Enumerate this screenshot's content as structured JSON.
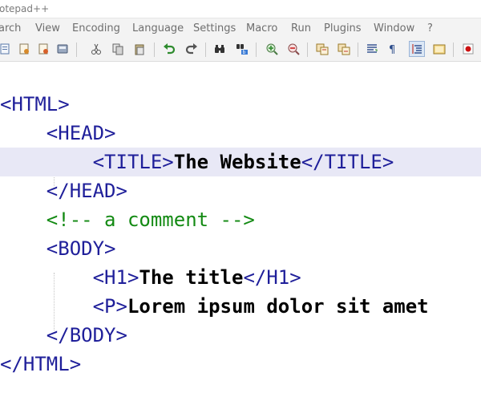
{
  "window": {
    "title": "otepad++"
  },
  "menubar": {
    "items": [
      "arch",
      "View",
      "Encoding",
      "Language",
      "Settings",
      "Macro",
      "Run",
      "Plugins",
      "Window",
      "?"
    ]
  },
  "toolbar": {
    "buttons": [
      "new-file-icon",
      "open-file-icon",
      "save-icon",
      "save-all-icon",
      "print-icon",
      "cut-icon",
      "copy-icon",
      "paste-icon",
      "undo-icon",
      "redo-icon",
      "find-icon",
      "replace-icon",
      "zoom-in-icon",
      "zoom-out-icon",
      "sync-vertical-icon",
      "sync-horizontal-icon",
      "word-wrap-icon",
      "show-all-chars-icon",
      "indent-guide-icon",
      "doc-map-icon",
      "record-macro-icon"
    ],
    "colors": {
      "record": "#cc1111",
      "undo": "#2e8b2e",
      "toolbar_bg": "#f3f3f3"
    }
  },
  "editor": {
    "current_line_color": "#e8e8f6",
    "lines": [
      {
        "indent": "",
        "tag_open": "<HTML>",
        "text": "",
        "tag_close": "",
        "comment": ""
      },
      {
        "indent": "    ",
        "tag_open": "<HEAD>",
        "text": "",
        "tag_close": "",
        "comment": ""
      },
      {
        "indent": "        ",
        "tag_open": "<TITLE>",
        "text": "The Website",
        "tag_close": "</TITLE>",
        "comment": ""
      },
      {
        "indent": "    ",
        "tag_open": "</HEAD>",
        "text": "",
        "tag_close": "",
        "comment": ""
      },
      {
        "indent": "    ",
        "tag_open": "",
        "text": "",
        "tag_close": "",
        "comment": "<!-- a comment -->"
      },
      {
        "indent": "    ",
        "tag_open": "<BODY>",
        "text": "",
        "tag_close": "",
        "comment": ""
      },
      {
        "indent": "        ",
        "tag_open": "<H1>",
        "text": "The title",
        "tag_close": "</H1>",
        "comment": ""
      },
      {
        "indent": "        ",
        "tag_open": "<P>",
        "text": "Lorem ipsum dolor sit amet",
        "tag_close": "",
        "comment": ""
      },
      {
        "indent": "    ",
        "tag_open": "</BODY>",
        "text": "",
        "tag_close": "",
        "comment": ""
      },
      {
        "indent": "",
        "tag_open": "</HTML>",
        "text": "",
        "tag_close": "",
        "comment": ""
      }
    ]
  }
}
